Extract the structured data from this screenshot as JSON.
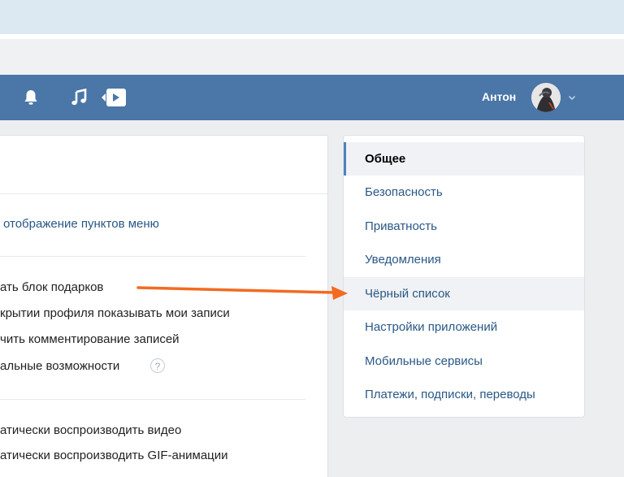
{
  "header": {
    "username": "Антон",
    "icons": [
      "bell-icon",
      "music-note-icon",
      "video-play-icon",
      "chevron-down-icon"
    ],
    "color": "#4a76a8"
  },
  "main": {
    "menu_display_link": "отображение пунктов меню",
    "options": [
      "ать блок подарков",
      "крытии профиля показывать мои записи",
      "чить комментирование записей",
      "альные возможности"
    ],
    "help_label": "?",
    "media_options": [
      "атически воспроизводить видео",
      "атически воспроизводить GIF-анимации"
    ]
  },
  "sidebar": {
    "items": [
      {
        "label": "Общее",
        "active": true
      },
      {
        "label": "Безопасность"
      },
      {
        "label": "Приватность"
      },
      {
        "label": "Уведомления"
      },
      {
        "label": "Чёрный список",
        "highlighted": true
      },
      {
        "label": "Настройки приложений"
      },
      {
        "label": "Мобильные сервисы"
      },
      {
        "label": "Платежи, подписки, переводы"
      }
    ]
  },
  "annotation": {
    "arrow_color": "#f26b21"
  }
}
